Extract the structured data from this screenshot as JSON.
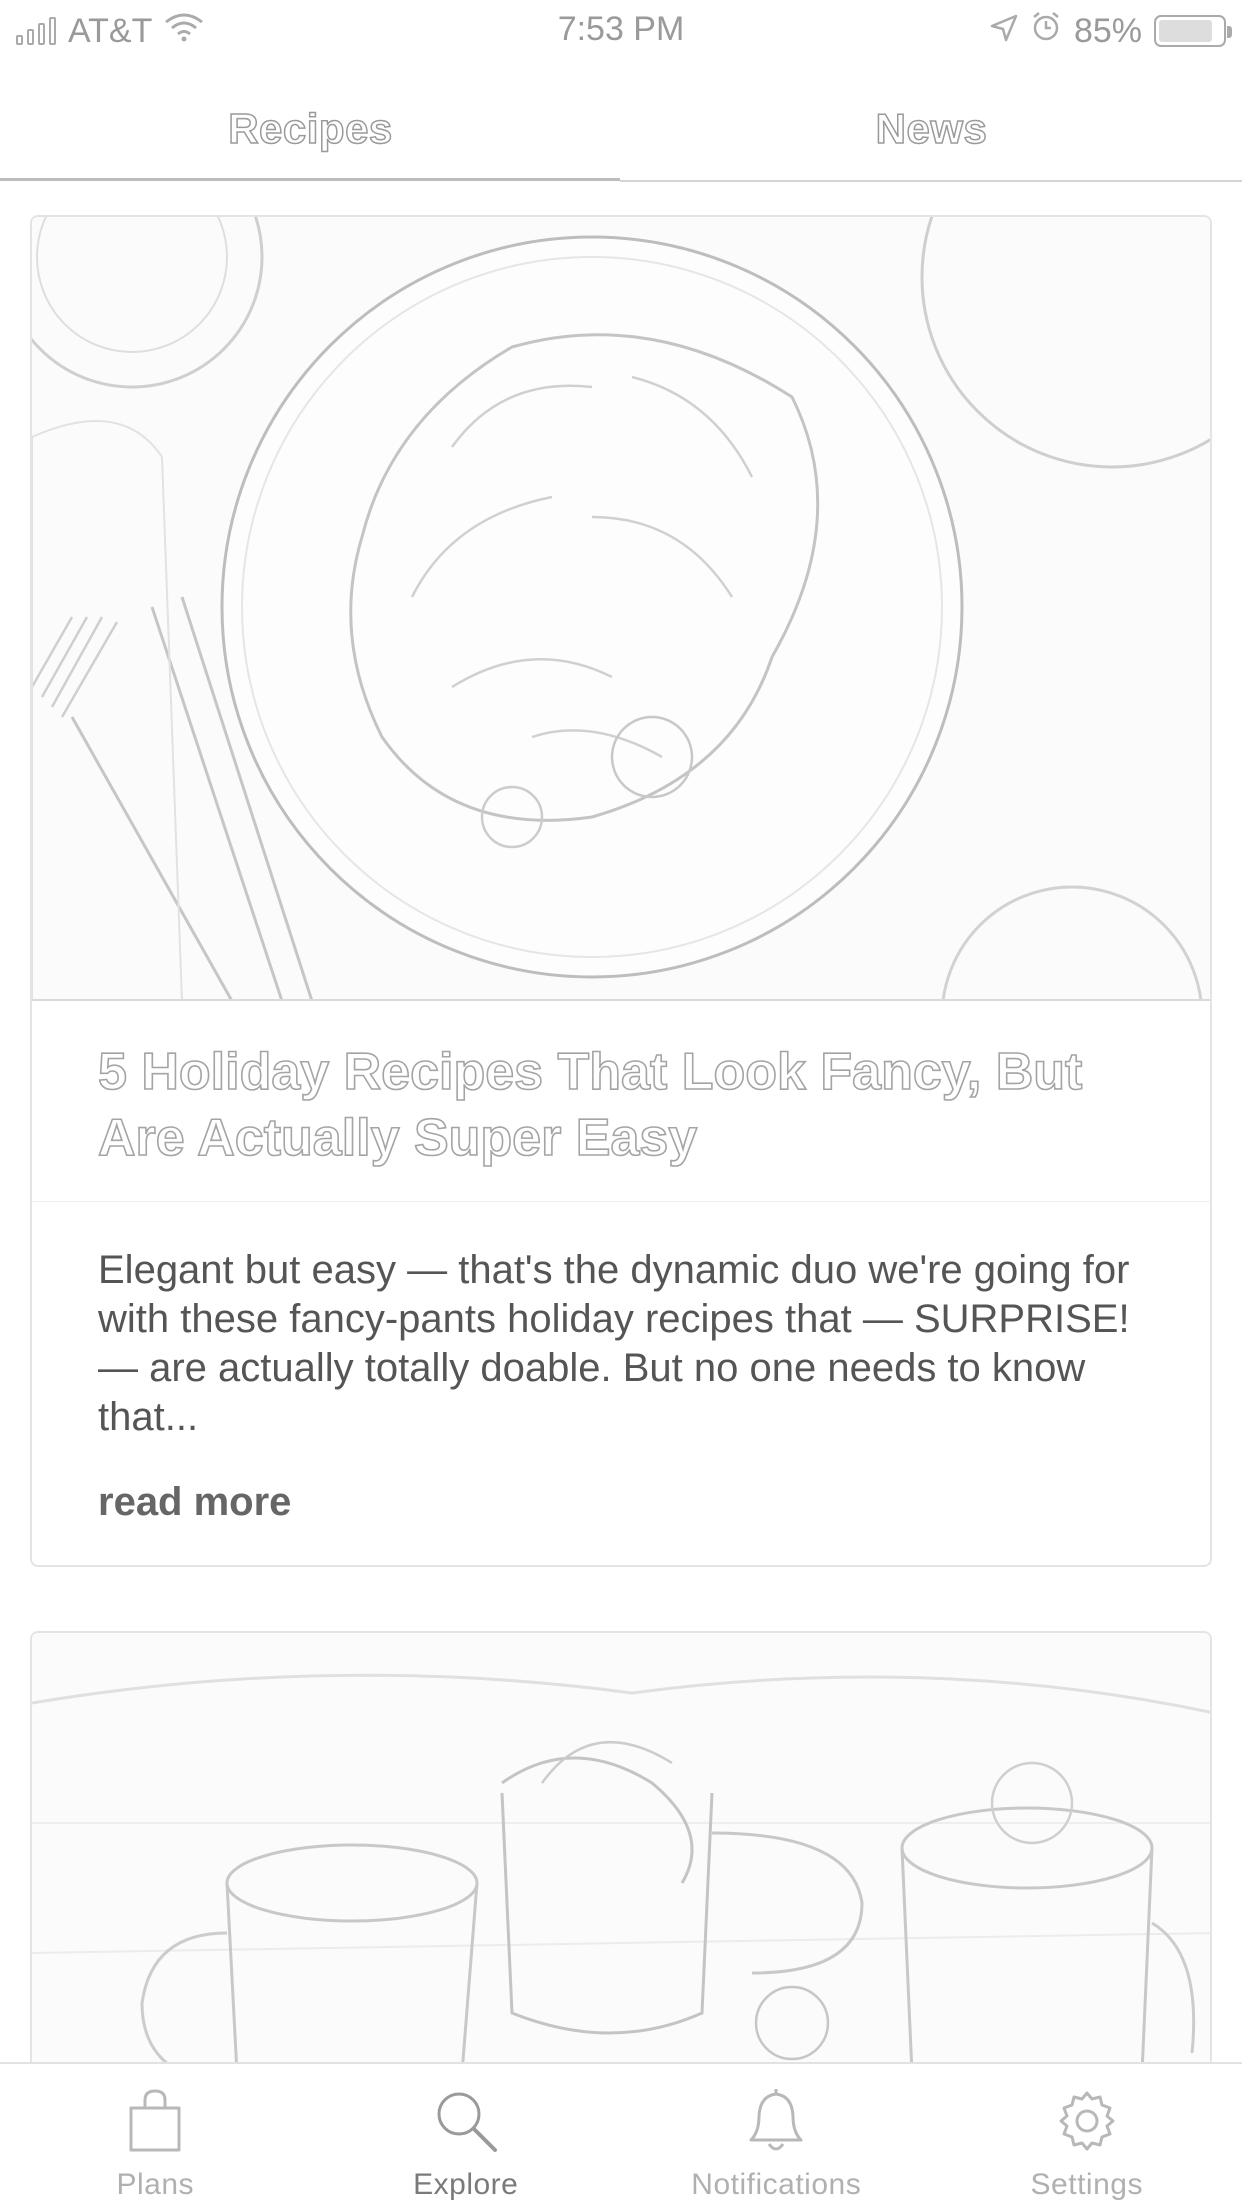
{
  "status_bar": {
    "carrier": "AT&T",
    "time": "7:53 PM",
    "battery": "85%",
    "battery_level": 0.85,
    "icons": [
      "signal-icon",
      "wifi-icon",
      "location-icon",
      "alarm-icon",
      "battery-icon"
    ]
  },
  "tabs": [
    {
      "label": "Recipes",
      "active": true
    },
    {
      "label": "News",
      "active": false
    }
  ],
  "feed": {
    "cards": [
      {
        "image": "holiday-plate-image",
        "title": "5 Holiday Recipes That Look Fancy, But Are Actually Super Easy",
        "excerpt": "Elegant but easy — that's the dynamic duo we're going for with these fancy-pants holiday recipes that — SURPRISE! — are actually totally doable. But no one needs to know that...",
        "link_label": "read more"
      },
      {
        "image": "mugs-drinks-image"
      }
    ]
  },
  "bottom_nav": [
    {
      "label": "Plans",
      "icon": "shopping-bag-icon",
      "active": false
    },
    {
      "label": "Explore",
      "icon": "search-icon",
      "active": true
    },
    {
      "label": "Notifications",
      "icon": "bell-icon",
      "active": false
    },
    {
      "label": "Settings",
      "icon": "gear-icon",
      "active": false
    }
  ],
  "colors": {
    "text_primary": "#555555",
    "text_muted": "#b0b0b0",
    "border": "#e4e4e4"
  }
}
